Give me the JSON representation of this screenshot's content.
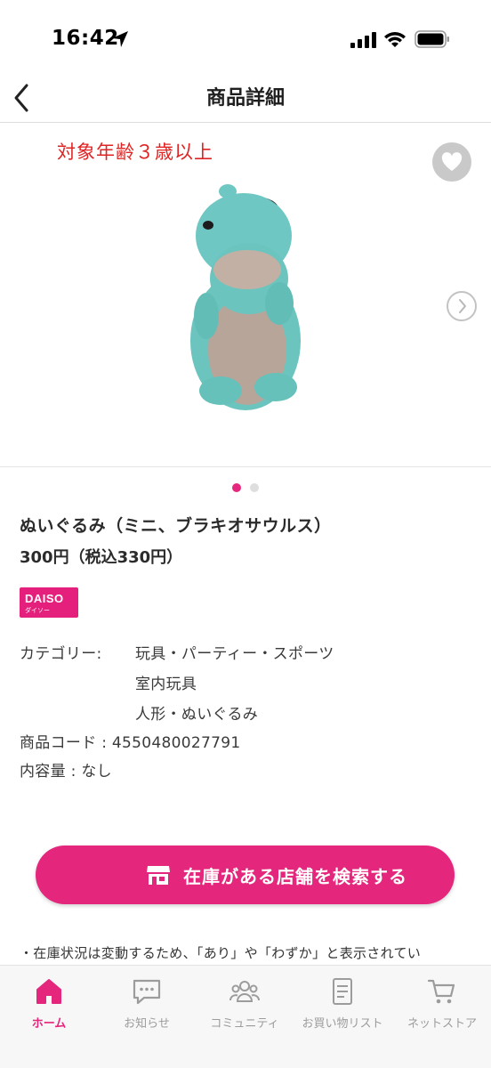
{
  "status_bar": {
    "time": "16:42"
  },
  "header": {
    "title": "商品詳細",
    "back_icon": "chevron-left-icon"
  },
  "gallery": {
    "age_label": "対象年齢３歳以上",
    "favorite_icon": "heart-icon",
    "next_icon": "chevron-right-icon",
    "image_subject": "dinosaur-plush-toy",
    "page_count": 2,
    "active_page": 1
  },
  "product": {
    "name": "ぬいぐるみ（ミニ、ブラキオサウルス）",
    "price": "300円（税込330円）",
    "brand_logo_text": "DAISO",
    "brand_logo_sub": "ダイソー",
    "category_label": "カテゴリー:",
    "categories": [
      "玩具・パーティー・スポーツ",
      "室内玩具",
      "人形・ぬいぐるみ"
    ],
    "code_text": "商品コード : 4550480027791",
    "volume_text": "内容量 : なし"
  },
  "actions": {
    "search_store_label": "在庫がある店舗を検索する",
    "search_store_icon": "store-icon"
  },
  "note_text": "・在庫状況は変動するため、「あり」や「わずか」と表示されてい",
  "tab_bar": {
    "items": [
      {
        "label": "ホーム",
        "icon": "home-icon",
        "active": true
      },
      {
        "label": "お知らせ",
        "icon": "chat-bubble-icon",
        "active": false
      },
      {
        "label": "コミュニティ",
        "icon": "people-icon",
        "active": false
      },
      {
        "label": "お買い物リスト",
        "icon": "document-list-icon",
        "active": false
      },
      {
        "label": "ネットストア",
        "icon": "cart-icon",
        "active": false
      }
    ]
  },
  "colors": {
    "accent": "#e4277c",
    "age_label": "#e02323",
    "inactive_tab": "#9c9c9c"
  }
}
